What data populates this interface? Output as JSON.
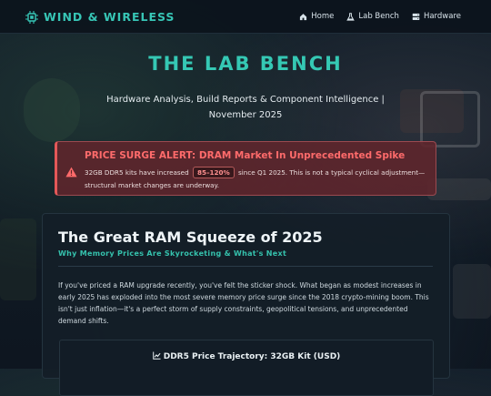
{
  "header": {
    "brand": "WIND & WIRELESS",
    "nav": [
      {
        "label": "Home",
        "icon": "home-icon"
      },
      {
        "label": "Lab Bench",
        "icon": "flask-icon"
      },
      {
        "label": "Hardware",
        "icon": "server-icon"
      }
    ]
  },
  "hero": {
    "title": "THE LAB BENCH",
    "subtitle": "Hardware Analysis, Build Reports & Component Intelligence | November 2025"
  },
  "alert": {
    "icon": "warning-icon",
    "title": "PRICE SURGE ALERT: DRAM Market In Unprecedented Spike",
    "body_before": "32GB DDR5 kits have increased",
    "badge": "85–120%",
    "body_after": "since Q1 2025. This is not a typical cyclical adjustment—structural market changes are underway."
  },
  "article": {
    "title": "The Great RAM Squeeze of 2025",
    "subtitle": "Why Memory Prices Are Skyrocketing & What's Next",
    "body": "If you've priced a RAM upgrade recently, you've felt the sticker shock. What began as modest increases in early 2025 has exploded into the most severe memory price surge since the 2018 crypto-mining boom. This isn't just inflation—it's a perfect storm of supply constraints, geopolitical tensions, and unprecedented demand shifts.",
    "chart_title": "DDR5 Price Trajectory: 32GB Kit (USD)",
    "chart_icon": "line-chart-icon"
  },
  "colors": {
    "accent": "#35c8b4",
    "alert_red": "#ff6b6b",
    "background": "#121c26"
  }
}
